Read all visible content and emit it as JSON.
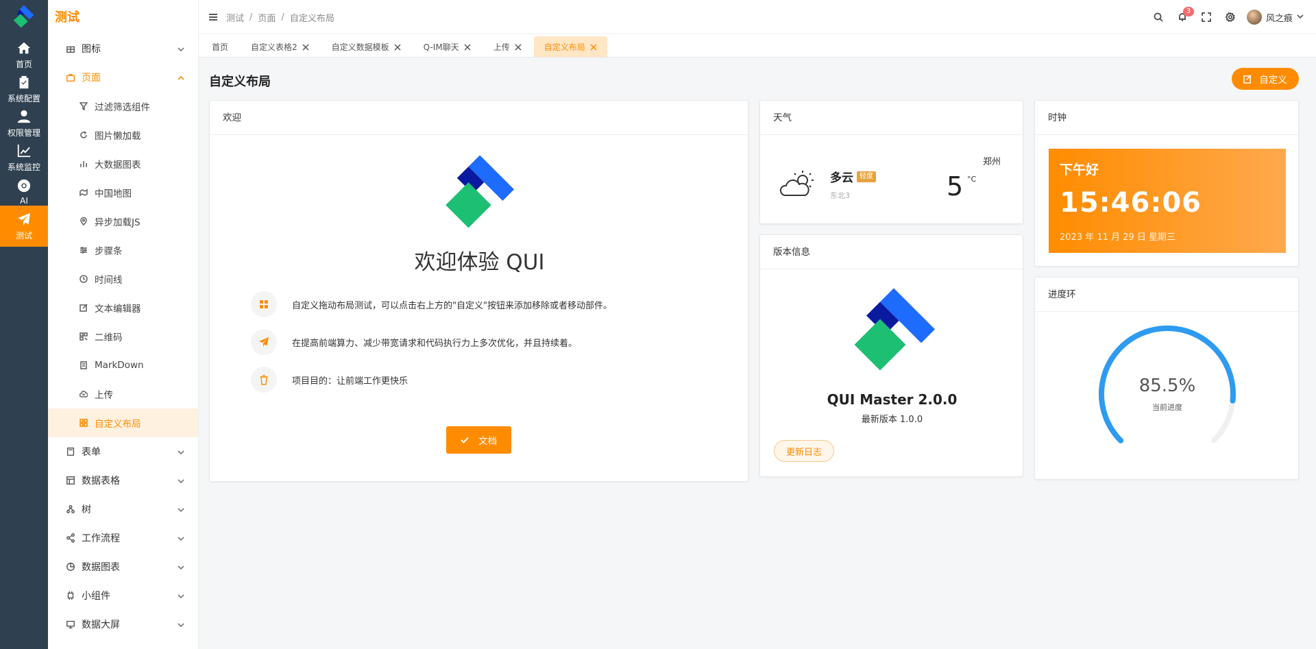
{
  "rail": {
    "items": [
      {
        "label": "首页",
        "icon": "home-icon"
      },
      {
        "label": "系统配置",
        "icon": "clipboard-check-icon"
      },
      {
        "label": "权限管理",
        "icon": "user-icon"
      },
      {
        "label": "系统监控",
        "icon": "chart-line-icon"
      },
      {
        "label": "AI",
        "icon": "chrome-icon"
      },
      {
        "label": "测试",
        "icon": "paper-plane-icon",
        "active": true
      }
    ]
  },
  "sidebar": {
    "title": "测试",
    "groups": [
      {
        "label": "图标",
        "icon": "gift-icon"
      },
      {
        "label": "页面",
        "icon": "briefcase-icon",
        "open": true
      }
    ],
    "sub_items": [
      {
        "label": "过滤筛选组件",
        "icon": "filter-icon"
      },
      {
        "label": "图片懒加载",
        "icon": "refresh-icon"
      },
      {
        "label": "大数据图表",
        "icon": "bar-chart-icon"
      },
      {
        "label": "中国地图",
        "icon": "map-icon"
      },
      {
        "label": "异步加载JS",
        "icon": "location-pin-icon"
      },
      {
        "label": "步骤条",
        "icon": "sliders-icon"
      },
      {
        "label": "时间线",
        "icon": "clock-icon"
      },
      {
        "label": "文本编辑器",
        "icon": "edit-icon"
      },
      {
        "label": "二维码",
        "icon": "qrcode-icon"
      },
      {
        "label": "MarkDown",
        "icon": "document-icon"
      },
      {
        "label": "上传",
        "icon": "cloud-upload-icon"
      },
      {
        "label": "自定义布局",
        "icon": "grid-icon",
        "active": true
      }
    ],
    "more_groups": [
      {
        "label": "表单",
        "icon": "form-icon"
      },
      {
        "label": "数据表格",
        "icon": "table-icon"
      },
      {
        "label": "树",
        "icon": "tree-icon"
      },
      {
        "label": "工作流程",
        "icon": "share-icon"
      },
      {
        "label": "数据图表",
        "icon": "pie-chart-icon"
      },
      {
        "label": "小组件",
        "icon": "chip-icon"
      },
      {
        "label": "数据大屏",
        "icon": "monitor-icon"
      }
    ]
  },
  "breadcrumb": [
    "测试",
    "页面",
    "自定义布局"
  ],
  "header": {
    "notification_count": "3",
    "user_name": "风之痕"
  },
  "tabs": [
    {
      "label": "首页",
      "closable": false
    },
    {
      "label": "自定义表格2",
      "closable": true
    },
    {
      "label": "自定义数据模板",
      "closable": true
    },
    {
      "label": "Q-IM聊天",
      "closable": true
    },
    {
      "label": "上传",
      "closable": true
    },
    {
      "label": "自定义布局",
      "closable": true,
      "active": true
    }
  ],
  "page": {
    "title": "自定义布局",
    "custom_button": "自定义"
  },
  "welcome": {
    "header": "欢迎",
    "title": "欢迎体验 QUI",
    "features": [
      {
        "text": "自定义拖动布局测试，可以点击右上方的\"自定义\"按钮来添加移除或者移动部件。",
        "icon": "apps-icon"
      },
      {
        "text": "在提高前端算力、减少带宽请求和代码执行力上多次优化，并且持续着。",
        "icon": "send-icon"
      },
      {
        "text": "项目目的：让前端工作更快乐",
        "icon": "trash-icon"
      }
    ],
    "doc_button": "文档"
  },
  "weather": {
    "header": "天气",
    "condition": "多云",
    "level": "轻度",
    "wind": "东北3",
    "city": "郑州",
    "temperature": "5",
    "unit": "°C"
  },
  "version": {
    "header": "版本信息",
    "name": "QUI Master 2.0.0",
    "latest": "最新版本 1.0.0",
    "changelog_button": "更新日志"
  },
  "clock": {
    "header": "时钟",
    "greeting": "下午好",
    "time": "15:46:06",
    "date": "2023 年 11 月 29 日 星期三"
  },
  "progress": {
    "header": "进度环",
    "value": 85.5,
    "value_text": "85.5%",
    "label": "当前进度"
  },
  "colors": {
    "accent": "#ff8c00",
    "rail": "#2f4050",
    "ring": "#2e9bf0"
  }
}
